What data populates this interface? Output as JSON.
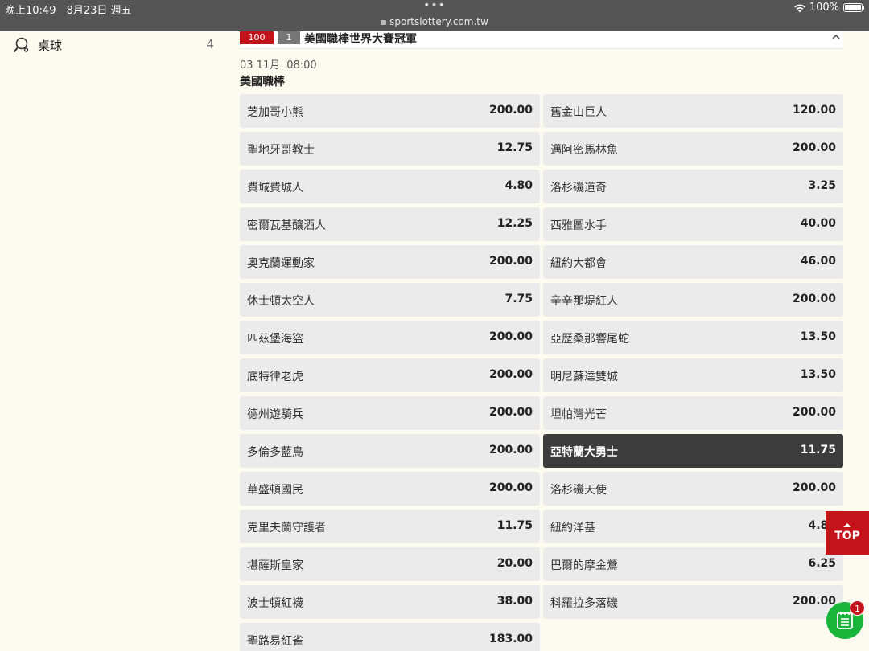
{
  "status_bar": {
    "time": "晚上10:49",
    "date": "8月23日 週五",
    "url": "sportslottery.com.tw",
    "battery": "100%"
  },
  "sidebar": {
    "items": [
      {
        "label": "桌球",
        "count": "4",
        "icon": "table-tennis-icon"
      }
    ]
  },
  "event": {
    "code": "100",
    "number": "1",
    "title": "美國職棒世界大賽冠軍",
    "date": "03 11月",
    "time": "08:00",
    "league": "美國職棒"
  },
  "teams": [
    {
      "name": "芝加哥小熊",
      "odds": "200.00"
    },
    {
      "name": "舊金山巨人",
      "odds": "120.00"
    },
    {
      "name": "聖地牙哥教士",
      "odds": "12.75"
    },
    {
      "name": "邁阿密馬林魚",
      "odds": "200.00"
    },
    {
      "name": "費城費城人",
      "odds": "4.80"
    },
    {
      "name": "洛杉磯道奇",
      "odds": "3.25"
    },
    {
      "name": "密爾瓦基釀酒人",
      "odds": "12.25"
    },
    {
      "name": "西雅圖水手",
      "odds": "40.00"
    },
    {
      "name": "奧克蘭運動家",
      "odds": "200.00"
    },
    {
      "name": "紐約大都會",
      "odds": "46.00"
    },
    {
      "name": "休士頓太空人",
      "odds": "7.75"
    },
    {
      "name": "辛辛那堤紅人",
      "odds": "200.00"
    },
    {
      "name": "匹茲堡海盜",
      "odds": "200.00"
    },
    {
      "name": "亞歷桑那響尾蛇",
      "odds": "13.50"
    },
    {
      "name": "底特律老虎",
      "odds": "200.00"
    },
    {
      "name": "明尼蘇達雙城",
      "odds": "13.50"
    },
    {
      "name": "德州遊騎兵",
      "odds": "200.00"
    },
    {
      "name": "坦帕灣光芒",
      "odds": "200.00"
    },
    {
      "name": "多倫多藍鳥",
      "odds": "200.00"
    },
    {
      "name": "亞特蘭大勇士",
      "odds": "11.75",
      "selected": true
    },
    {
      "name": "華盛頓國民",
      "odds": "200.00"
    },
    {
      "name": "洛杉磯天使",
      "odds": "200.00"
    },
    {
      "name": "克里夫蘭守護者",
      "odds": "11.75"
    },
    {
      "name": "紐約洋基",
      "odds": "4.80"
    },
    {
      "name": "堪薩斯皇家",
      "odds": "20.00"
    },
    {
      "name": "巴爾的摩金鶯",
      "odds": "6.25"
    },
    {
      "name": "波士頓紅襪",
      "odds": "38.00"
    },
    {
      "name": "科羅拉多落磯",
      "odds": "200.00"
    },
    {
      "name": "聖路易紅雀",
      "odds": "183.00"
    }
  ],
  "top_button": {
    "label": "TOP"
  },
  "cart": {
    "count": "1"
  },
  "colors": {
    "accent_red": "#c4131b",
    "selected": "#3c3c3c",
    "cart_green": "#19b43a",
    "background": "#fdfbf0"
  }
}
